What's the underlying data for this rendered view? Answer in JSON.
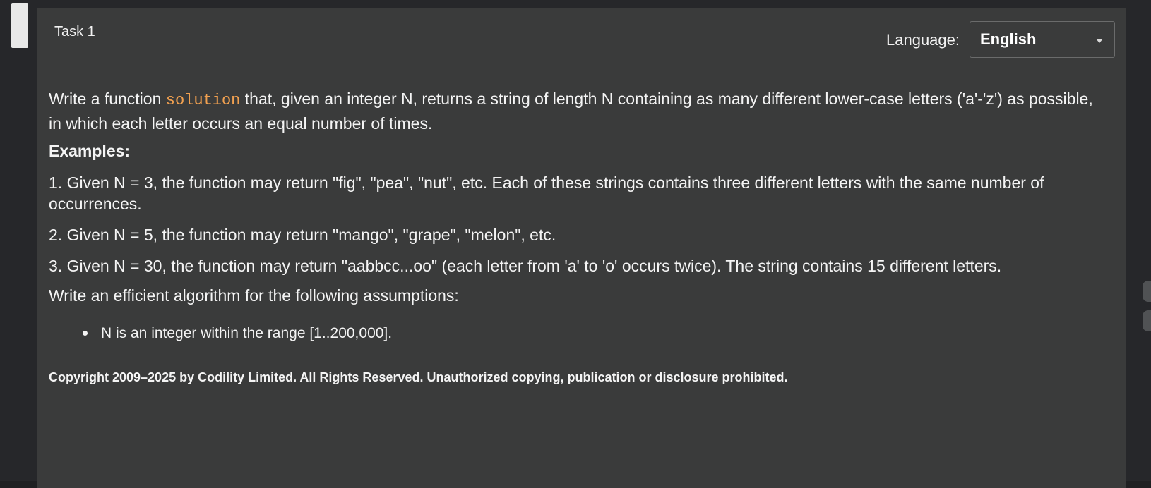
{
  "header": {
    "task_title": "Task 1",
    "language_label": "Language:",
    "language_value": "English"
  },
  "problem": {
    "intro_before": "Write a function ",
    "function_name": "solution",
    "intro_after": " that, given an integer N, returns a string of length N containing as many different lower-case letters ('a'-'z') as possible, in which each letter occurs an equal number of times.",
    "examples_heading": "Examples:",
    "examples": [
      "1. Given N = 3, the function may return \"fig\", \"pea\", \"nut\", etc. Each of these strings contains three different letters with the same number of occurrences.",
      "2. Given N = 5, the function may return \"mango\", \"grape\", \"melon\", etc.",
      "3. Given N = 30, the function may return \"aabbcc...oo\" (each letter from 'a' to 'o' occurs twice). The string contains 15 different letters."
    ],
    "assumptions_heading": "Write an efficient algorithm for the following assumptions:",
    "assumptions": [
      "N is an integer within the range [1..200,000]."
    ],
    "copyright": "Copyright 2009–2025 by Codility Limited. All Rights Reserved. Unauthorized copying, publication or disclosure prohibited."
  },
  "colors": {
    "panel_bg": "#3a3b3b",
    "code_accent": "#f0a050",
    "text": "#f4f4f4"
  }
}
